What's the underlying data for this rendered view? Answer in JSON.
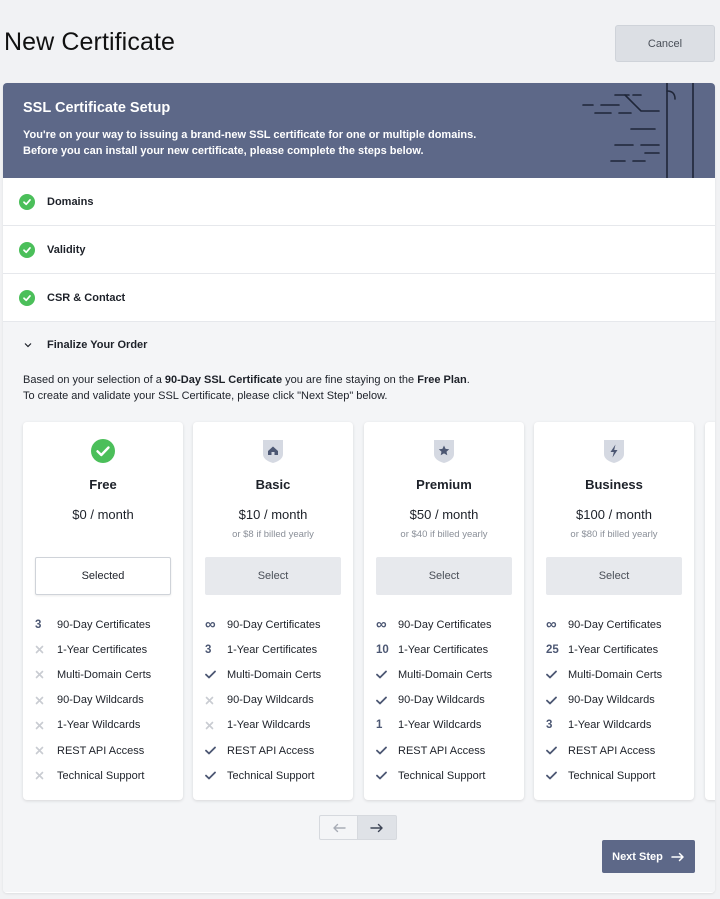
{
  "header": {
    "title": "New Certificate",
    "cancel_label": "Cancel"
  },
  "hero": {
    "title": "SSL Certificate Setup",
    "line1": "You're on your way to issuing a brand-new SSL certificate for one or multiple domains.",
    "line2": "Before you can install your new certificate, please complete the steps below."
  },
  "steps": [
    {
      "label": "Domains",
      "status": "complete"
    },
    {
      "label": "Validity",
      "status": "complete"
    },
    {
      "label": "CSR & Contact",
      "status": "complete"
    }
  ],
  "finalize": {
    "label": "Finalize Your Order",
    "intro_a": "Based on your selection of a ",
    "intro_b": "90-Day SSL Certificate",
    "intro_c": " you are fine staying on the ",
    "intro_d": "Free Plan",
    "intro_e": ".",
    "intro_line2": "To create and validate your SSL Certificate, please click \"Next Step\" below."
  },
  "plans": [
    {
      "name": "Free",
      "price": "$0 / month",
      "yearly": "",
      "button": "Selected",
      "selected": true,
      "icon": "check-circle-icon",
      "features": [
        {
          "mark": "3",
          "label": "90-Day Certificates"
        },
        {
          "mark": "x",
          "label": "1-Year Certificates"
        },
        {
          "mark": "x",
          "label": "Multi-Domain Certs"
        },
        {
          "mark": "x",
          "label": "90-Day Wildcards"
        },
        {
          "mark": "x",
          "label": "1-Year Wildcards"
        },
        {
          "mark": "x",
          "label": "REST API Access"
        },
        {
          "mark": "x",
          "label": "Technical Support"
        }
      ]
    },
    {
      "name": "Basic",
      "price": "$10 / month",
      "yearly": "or $8 if billed yearly",
      "button": "Select",
      "selected": false,
      "icon": "home-shield-icon",
      "features": [
        {
          "mark": "∞",
          "label": "90-Day Certificates"
        },
        {
          "mark": "3",
          "label": "1-Year Certificates"
        },
        {
          "mark": "✓",
          "label": "Multi-Domain Certs"
        },
        {
          "mark": "x",
          "label": "90-Day Wildcards"
        },
        {
          "mark": "x",
          "label": "1-Year Wildcards"
        },
        {
          "mark": "✓",
          "label": "REST API Access"
        },
        {
          "mark": "✓",
          "label": "Technical Support"
        }
      ]
    },
    {
      "name": "Premium",
      "price": "$50 / month",
      "yearly": "or $40 if billed yearly",
      "button": "Select",
      "selected": false,
      "icon": "star-shield-icon",
      "features": [
        {
          "mark": "∞",
          "label": "90-Day Certificates"
        },
        {
          "mark": "10",
          "label": "1-Year Certificates"
        },
        {
          "mark": "✓",
          "label": "Multi-Domain Certs"
        },
        {
          "mark": "✓",
          "label": "90-Day Wildcards"
        },
        {
          "mark": "1",
          "label": "1-Year Wildcards"
        },
        {
          "mark": "✓",
          "label": "REST API Access"
        },
        {
          "mark": "✓",
          "label": "Technical Support"
        }
      ]
    },
    {
      "name": "Business",
      "price": "$100 / month",
      "yearly": "or $80 if billed yearly",
      "button": "Select",
      "selected": false,
      "icon": "bolt-shield-icon",
      "features": [
        {
          "mark": "∞",
          "label": "90-Day Certificates"
        },
        {
          "mark": "25",
          "label": "1-Year Certificates"
        },
        {
          "mark": "✓",
          "label": "Multi-Domain Certs"
        },
        {
          "mark": "✓",
          "label": "90-Day Wildcards"
        },
        {
          "mark": "3",
          "label": "1-Year Wildcards"
        },
        {
          "mark": "✓",
          "label": "REST API Access"
        },
        {
          "mark": "✓",
          "label": "Technical Support"
        }
      ]
    }
  ],
  "pager": {
    "prev_icon": "arrow-left-icon",
    "next_icon": "arrow-right-icon"
  },
  "footer": {
    "next_label": "Next Step"
  },
  "colors": {
    "accent": "#5d6888",
    "success": "#4bbf5a",
    "mark": "#4c5773",
    "muted": "#c9ccd2"
  }
}
